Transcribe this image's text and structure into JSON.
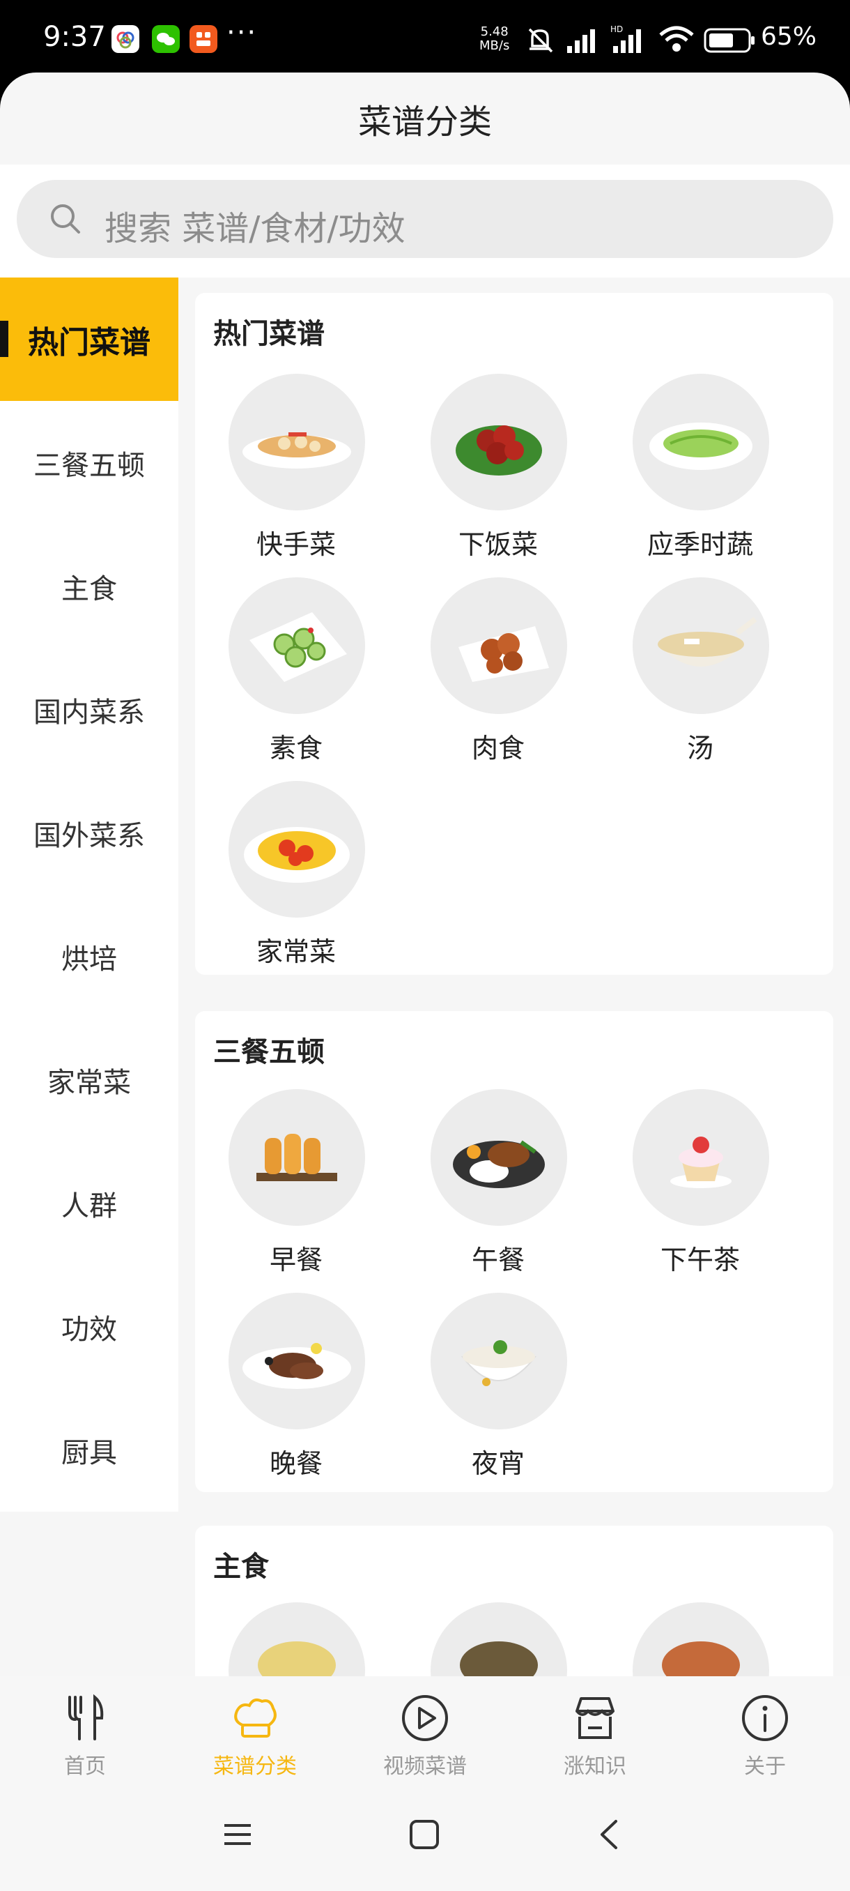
{
  "status_bar": {
    "time": "9:37",
    "more": "···",
    "speed_value": "5.48",
    "speed_unit": "MB/s",
    "battery": "65%"
  },
  "header": {
    "title": "菜谱分类"
  },
  "search": {
    "placeholder": "搜索 菜谱/食材/功效"
  },
  "sidebar": {
    "items": [
      {
        "label": "热门菜谱"
      },
      {
        "label": "三餐五顿"
      },
      {
        "label": "主食"
      },
      {
        "label": "国内菜系"
      },
      {
        "label": "国外菜系"
      },
      {
        "label": "烘培"
      },
      {
        "label": "家常菜"
      },
      {
        "label": "人群"
      },
      {
        "label": "功效"
      },
      {
        "label": "厨具"
      }
    ],
    "active_index": 0
  },
  "sections": [
    {
      "title": "热门菜谱",
      "items": [
        {
          "label": "快手菜",
          "icon": "lotus-root-dish"
        },
        {
          "label": "下饭菜",
          "icon": "braised-pork-dish"
        },
        {
          "label": "应季时蔬",
          "icon": "green-vegetable-dish"
        },
        {
          "label": "素食",
          "icon": "cucumber-salad-dish"
        },
        {
          "label": "肉食",
          "icon": "meat-dish"
        },
        {
          "label": "汤",
          "icon": "soup-bowl"
        },
        {
          "label": "家常菜",
          "icon": "tomato-egg-dish"
        }
      ]
    },
    {
      "title": "三餐五顿",
      "items": [
        {
          "label": "早餐",
          "icon": "fried-dough-sticks"
        },
        {
          "label": "午餐",
          "icon": "rice-bento"
        },
        {
          "label": "下午茶",
          "icon": "strawberry-cupcake"
        },
        {
          "label": "晚餐",
          "icon": "steak-plate"
        },
        {
          "label": "夜宵",
          "icon": "noodle-bowl"
        }
      ]
    },
    {
      "title": "主食",
      "items": [
        {
          "label": "",
          "icon": "fried-rice"
        },
        {
          "label": "",
          "icon": "mushroom-bowl"
        },
        {
          "label": "",
          "icon": "noodles-plate"
        }
      ]
    }
  ],
  "bottom_nav": {
    "items": [
      {
        "label": "首页",
        "icon": "fork-knife-icon"
      },
      {
        "label": "菜谱分类",
        "icon": "chef-hat-icon"
      },
      {
        "label": "视频菜谱",
        "icon": "play-circle-icon"
      },
      {
        "label": "涨知识",
        "icon": "store-icon"
      },
      {
        "label": "关于",
        "icon": "info-icon"
      }
    ],
    "active_index": 1
  },
  "colors": {
    "accent": "#fbbc0a",
    "active_nav": "#f6b711",
    "muted": "#999999"
  }
}
